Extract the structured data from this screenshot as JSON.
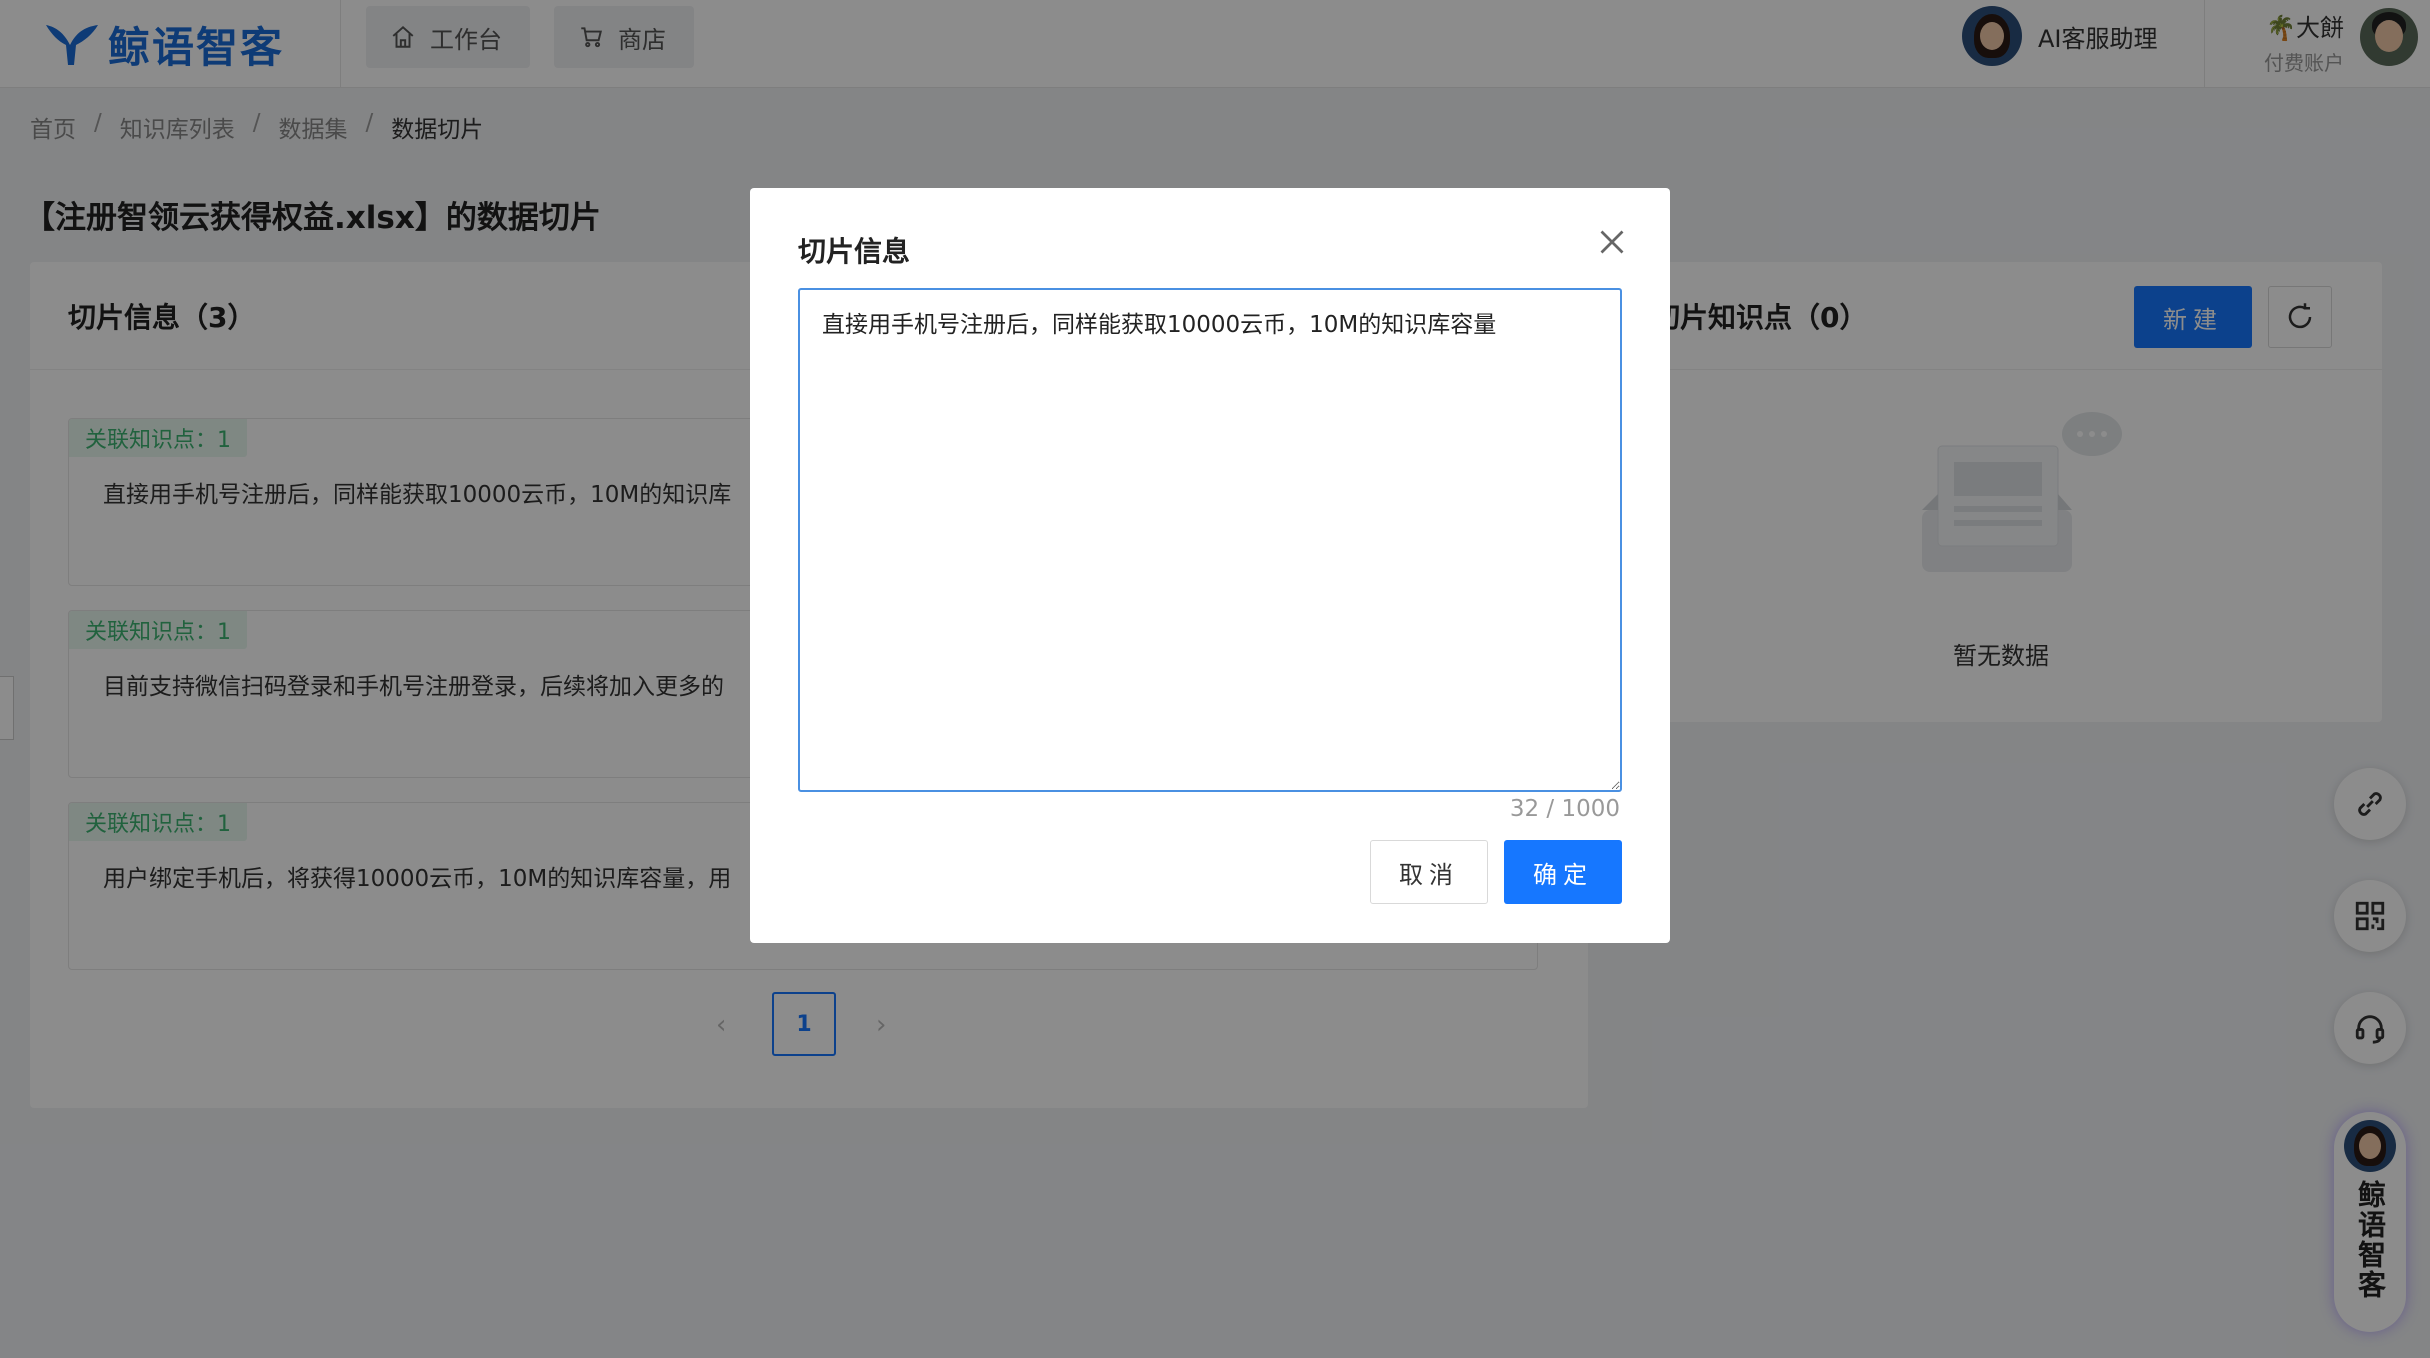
{
  "header": {
    "brand": "鲸语智客",
    "nav": [
      {
        "label": "工作台",
        "icon": "home-icon"
      },
      {
        "label": "商店",
        "icon": "cart-icon"
      }
    ],
    "assistant_label": "AI客服助理",
    "user_name": "🌴大餅",
    "user_plan": "付费账户"
  },
  "breadcrumb": [
    "首页",
    "知识库列表",
    "数据集",
    "数据切片"
  ],
  "breadcrumb_sep": "/",
  "page_title": "【注册智领云获得权益.xlsx】的数据切片",
  "left_panel": {
    "title": "切片信息（3）",
    "chunks": [
      {
        "tag": "关联知识点：1",
        "text": "直接用手机号注册后，同样能获取10000云币，10M的知识库"
      },
      {
        "tag": "关联知识点：1",
        "text": "目前支持微信扫码登录和手机号注册登录，后续将加入更多的"
      },
      {
        "tag": "关联知识点：1",
        "text": "用户绑定手机后，将获得10000云币，10M的知识库容量，用"
      }
    ],
    "pager": {
      "prev": "‹",
      "current": "1",
      "next": "›"
    }
  },
  "right_panel": {
    "title": "切片知识点（0）",
    "new_label": "新建",
    "empty_text": "暂无数据"
  },
  "float_brand": "鲸语智客",
  "modal": {
    "title": "切片信息",
    "content": "直接用手机号注册后，同样能获取10000云币，10M的知识库容量",
    "count": "32 / 1000",
    "cancel_label": "取消",
    "ok_label": "确定"
  },
  "colors": {
    "primary": "#1677ff",
    "brand": "#1a6cd8",
    "tag_bg": "#e8f7ef",
    "tag_text": "#3cb371"
  }
}
